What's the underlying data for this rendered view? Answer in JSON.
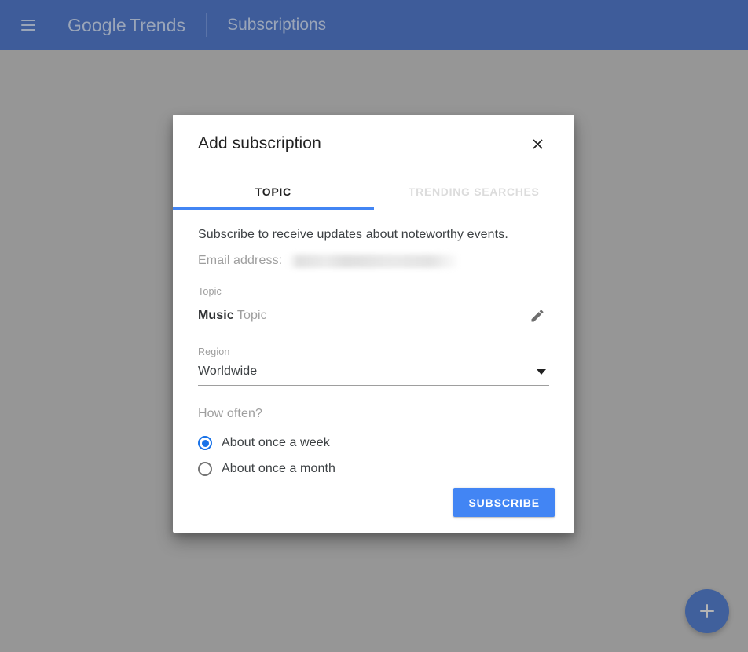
{
  "appbar": {
    "menu_icon": "hamburger-menu-icon",
    "brand_google": "Google",
    "brand_trends": "Trends",
    "section": "Subscriptions"
  },
  "fab": {
    "icon": "plus-icon",
    "color": "#40609c"
  },
  "dialog": {
    "title": "Add subscription",
    "close_icon": "close-icon",
    "tabs": [
      {
        "label": "TOPIC",
        "active": true
      },
      {
        "label": "TRENDING SEARCHES",
        "active": false
      }
    ],
    "intro": "Subscribe to receive updates about noteworthy events.",
    "email": {
      "label": "Email address:",
      "value": "",
      "redacted": true
    },
    "topic": {
      "label": "Topic",
      "name": "Music",
      "kind": "Topic",
      "edit_icon": "pencil-edit-icon"
    },
    "region": {
      "label": "Region",
      "value": "Worldwide",
      "caret_icon": "chevron-down-icon"
    },
    "frequency": {
      "label": "How often?",
      "options": [
        {
          "label": "About once a week",
          "selected": true
        },
        {
          "label": "About once a month",
          "selected": false
        }
      ]
    },
    "submit_label": "SUBSCRIBE"
  },
  "colors": {
    "appbar_blue": "#3e5c9a",
    "accent_blue": "#4285f4",
    "radio_blue": "#1a73e8",
    "scrim_gray": "#969696"
  }
}
